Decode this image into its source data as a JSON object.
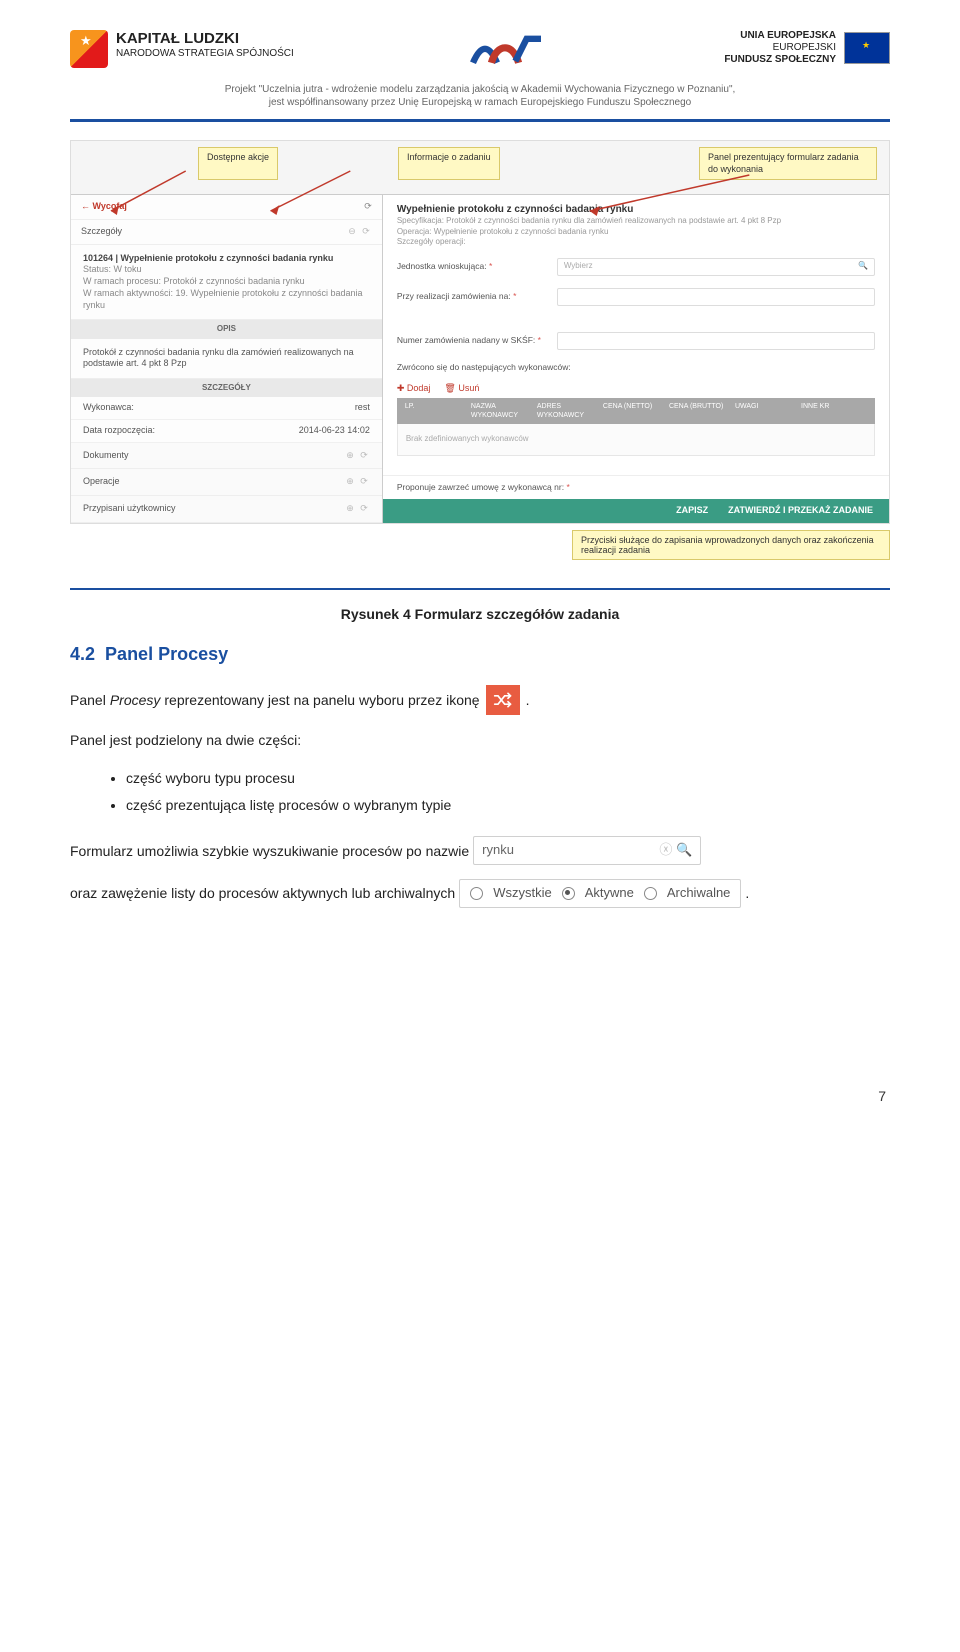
{
  "header": {
    "kl_title": "KAPITAŁ LUDZKI",
    "kl_sub": "NARODOWA STRATEGIA SPÓJNOŚCI",
    "eu_top": "UNIA EUROPEJSKA",
    "eu_mid": "EUROPEJSKI",
    "eu_bot": "FUNDUSZ SPOŁECZNY",
    "proj_line1": "Projekt \"Uczelnia jutra - wdrożenie modelu zarządzania jakością w Akademii Wychowania Fizycznego w Poznaniu\",",
    "proj_line2": "jest współfinansowany przez Unię Europejską w ramach Europejskiego Funduszu Społecznego"
  },
  "callouts": {
    "actions": "Dostępne akcje",
    "info": "Informacje o zadaniu",
    "formpanel": "Panel prezentujący formularz zadania do wykonania",
    "bottom": "Przyciski służące do zapisania wprowadzonych danych oraz zakończenia realizacji zadania"
  },
  "leftpanel": {
    "withdraw": "Wycofaj",
    "details": "Szczegóły",
    "task_title": "101264 | Wypełnienie protokołu z czynności badania rynku",
    "status": "Status: W toku",
    "proc": "W ramach procesu: Protokół z czynności badania rynku",
    "act": "W ramach aktywności: 19. Wypełnienie protokołu z czynności badania rynku",
    "opis_head": "OPIS",
    "opis_body": "Protokół z czynności badania rynku dla zamówień realizowanych na podstawie art. 4 pkt 8 Pzp",
    "szcz_head": "SZCZEGÓŁY",
    "wyk_label": "Wykonawca:",
    "wyk_val": "rest",
    "date_label": "Data rozpoczęcia:",
    "date_val": "2014-06-23 14:02",
    "docs": "Dokumenty",
    "ops": "Operacje",
    "users": "Przypisani użytkownicy"
  },
  "rightpanel": {
    "title": "Wypełnienie protokołu z czynności badania rynku",
    "spec": "Specyfikacja: Protokół z czynności badania rynku dla zamówień realizowanych na podstawie art. 4 pkt 8 Pzp",
    "op": "Operacja: Wypełnienie protokołu z czynności badania rynku",
    "opdet": "Szczegóły operacji:",
    "unit_label": "Jednostka wnioskująca:",
    "unit_placeholder": "Wybierz",
    "real_label": "Przy realizacji zamówienia na:",
    "num_label": "Numer zamówienia nadany w SKŚF:",
    "turned_label": "Zwrócono się do następujących wykonawców:",
    "add": "Dodaj",
    "del": "Usuń",
    "cols": [
      "LP.",
      "NAZWA WYKONAWCY",
      "ADRES WYKONAWCY",
      "CENA (NETTO)",
      "CENA (BRUTTO)",
      "UWAGI",
      "INNE KR"
    ],
    "empty": "Brak zdefiniowanych wykonawców",
    "cutline": "Proponuje zawrzeć umowę z wykonawcą nr:",
    "save": "ZAPISZ",
    "submit": "ZATWIERDŹ I PRZEKAŻ ZADANIE"
  },
  "body": {
    "caption": "Rysunek 4 Formularz szczegółów zadania",
    "h2_num": "4.2",
    "h2_text": "Panel Procesy",
    "p1a": "Panel ",
    "p1_em": "Procesy",
    "p1b": " reprezentowany jest na panelu wyboru przez ikonę ",
    "p1c": ".",
    "p2": "Panel jest podzielony na dwie części:",
    "li1": "część wyboru typu procesu",
    "li2": "część prezentująca listę procesów o wybranym typie",
    "p3a": "Formularz umożliwia szybkie wyszukiwanie procesów po nazwie ",
    "search_text": "rynku",
    "p4a": "oraz zawężenie listy do procesów aktywnych lub archiwalnych ",
    "r_all": "Wszystkie",
    "r_act": "Aktywne",
    "r_arc": "Archiwalne",
    "p4b": "."
  },
  "pagenum": "7"
}
